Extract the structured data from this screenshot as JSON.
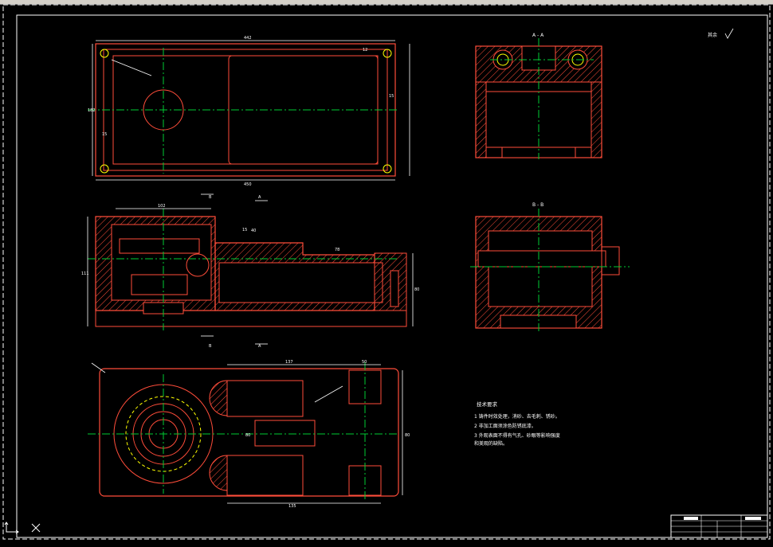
{
  "views": {
    "section_aa_label": "A - A",
    "section_bb_label": "B - B",
    "cut_marker_b": "B",
    "cut_marker_a": "A"
  },
  "dimensions": {
    "top_width": "442",
    "top_overall": "450",
    "top_height": "182",
    "top_15a": "15",
    "top_15b": "15",
    "top_12": "12",
    "front_height": "111",
    "front_102": "102",
    "front_15": "15",
    "front_78": "78",
    "front_40": "40",
    "front_right_h": "80",
    "plan_137": "137",
    "plan_50": "50",
    "plan_135": "135",
    "plan_right": "80",
    "plan_circle": "80"
  },
  "notes": {
    "roughness": "其余",
    "title": "技术要求",
    "items": [
      "1   铸件时效处理，消砂、去毛刺、锈砂。",
      "2   非加工面须涂色防锈底漆。",
      "3   外观表面不得有气孔、砂眼等影响强度",
      "     和美观的缺陷。"
    ]
  },
  "colors": {
    "outline": "#ff4d3a",
    "center": "#00cc33",
    "dim": "#ffffff",
    "hatch": "#ff4d3a",
    "yellow": "#ffff00",
    "cyan": "#00ffff"
  }
}
